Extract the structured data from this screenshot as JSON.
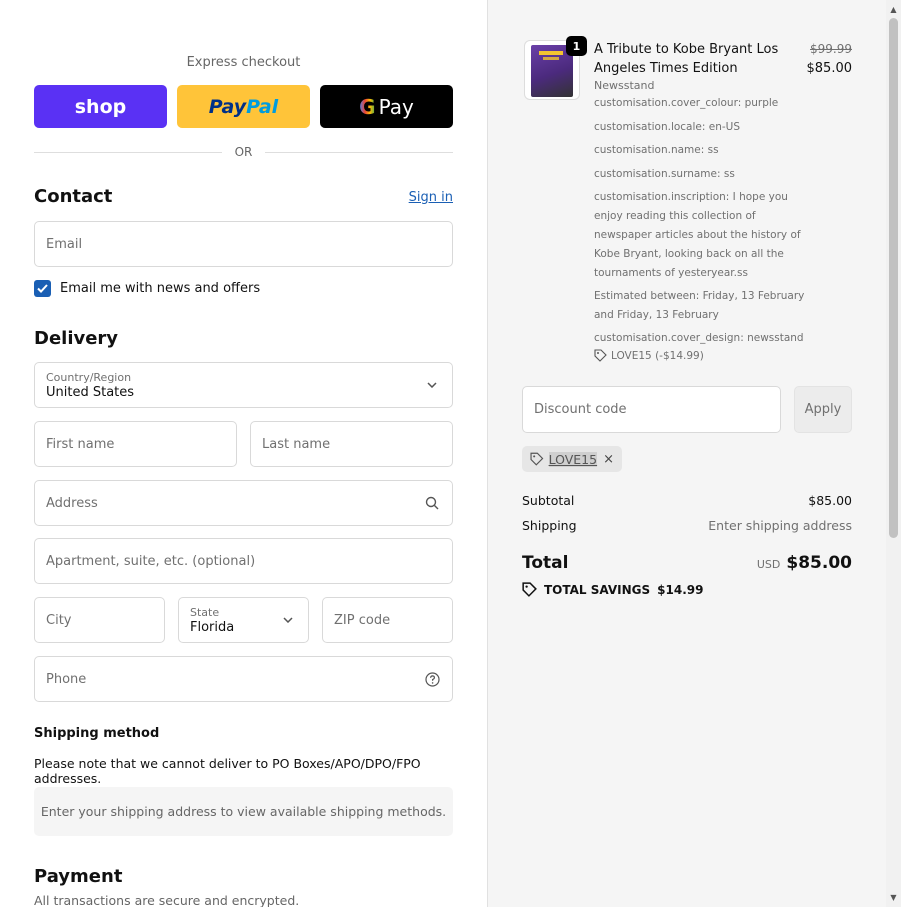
{
  "express": {
    "title": "Express checkout",
    "shop_label": "shop",
    "paypal_label_1": "Pay",
    "paypal_label_2": "Pal",
    "gpay_g": "G",
    "gpay_label": "Pay",
    "or_label": "OR"
  },
  "contact": {
    "heading": "Contact",
    "sign_in": "Sign in",
    "email_placeholder": "Email",
    "news_checkbox_label": "Email me with news and offers",
    "news_checked": true
  },
  "delivery": {
    "heading": "Delivery",
    "country_label": "Country/Region",
    "country_value": "United States",
    "first_name_placeholder": "First name",
    "last_name_placeholder": "Last name",
    "address_placeholder": "Address",
    "apartment_placeholder": "Apartment, suite, etc. (optional)",
    "city_placeholder": "City",
    "state_label": "State",
    "state_value": "Florida",
    "zip_placeholder": "ZIP code",
    "phone_placeholder": "Phone"
  },
  "shipping_method": {
    "title": "Shipping method",
    "note": "Please note that we cannot deliver to PO Boxes/APO/DPO/FPO addresses.",
    "info": "Enter your shipping address to view available shipping methods."
  },
  "payment": {
    "heading": "Payment",
    "subtitle": "All transactions are secure and encrypted."
  },
  "cart": {
    "quantity": "1",
    "product_title": "A Tribute to Kobe Bryant Los Angeles Times Edition",
    "compare_price": "$99.99",
    "price": "$85.00",
    "vendor": "Newsstand",
    "options": [
      "customisation.cover_colour: purple",
      "customisation.locale: en-US",
      "customisation.name: ss",
      "customisation.surname: ss",
      "customisation.inscription: I hope you enjoy reading this collection of newspaper articles about the history of Kobe Bryant, looking back on all the tournaments of yesteryear.ss",
      "Estimated between: Friday, 13 February and Friday, 13 February",
      "customisation.cover_design: newsstand"
    ],
    "line_discount": "LOVE15 (-$14.99)"
  },
  "discount": {
    "placeholder": "Discount code",
    "apply_label": "Apply",
    "applied_code": "LOVE15",
    "remove_icon": "×"
  },
  "summary": {
    "subtotal_label": "Subtotal",
    "subtotal_value": "$85.00",
    "shipping_label": "Shipping",
    "shipping_value": "Enter shipping address",
    "total_label": "Total",
    "currency": "USD",
    "total_value": "$85.00",
    "savings_label": "TOTAL SAVINGS",
    "savings_value": "$14.99"
  },
  "colors": {
    "shop": "#5a31f4",
    "paypal": "#ffc439",
    "gpay": "#000000",
    "link": "#1a5fb4",
    "summary_bg": "#f5f5f5"
  }
}
